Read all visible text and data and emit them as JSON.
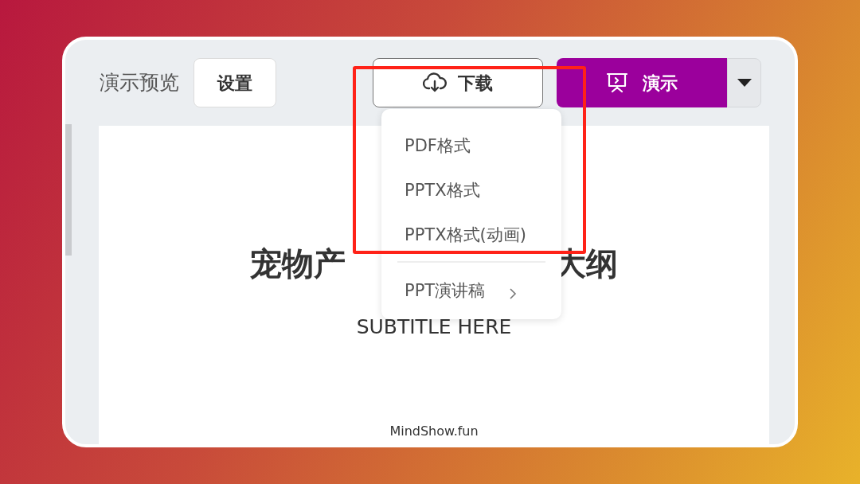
{
  "toolbar": {
    "title": "演示预览",
    "settings_button": "设置",
    "download_button": "下载",
    "present_button": "演示"
  },
  "download_menu": [
    {
      "kind": "item",
      "label": "PDF格式"
    },
    {
      "kind": "item",
      "label": "PPTX格式"
    },
    {
      "kind": "item",
      "label": "PPTX格式(动画)"
    },
    {
      "kind": "divider"
    },
    {
      "kind": "submenu",
      "label": "PPT演讲稿"
    }
  ],
  "slide": {
    "title_parts": [
      "宠物产",
      "大纲"
    ],
    "subtitle": "SUBTITLE HERE",
    "footer": "MindShow.fun"
  }
}
